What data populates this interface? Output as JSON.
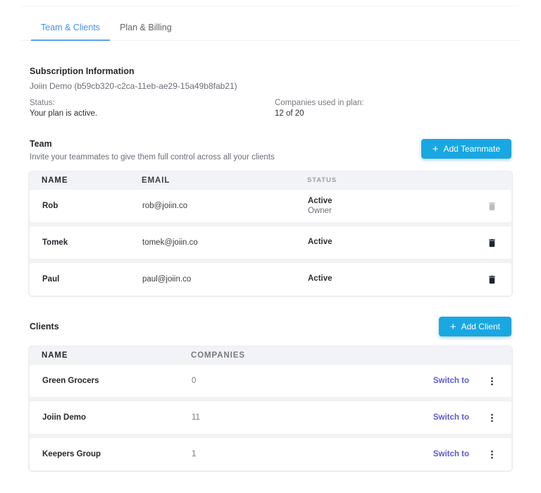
{
  "tabs": [
    {
      "label": "Team & Clients",
      "active": true
    },
    {
      "label": "Plan & Billing",
      "active": false
    }
  ],
  "subscription": {
    "title": "Subscription Information",
    "account": "Joiin Demo (b59cb320-c2ca-11eb-ae29-15a49b8fab21)",
    "status_label": "Status:",
    "status_value": "Your plan is active.",
    "companies_label": "Companies used in plan:",
    "companies_value": "12 of 20"
  },
  "icons": {
    "plus": "+"
  },
  "colors": {
    "accent_blue": "#19a7e2",
    "tab_active": "#478fea",
    "switch_link": "#5b5bd6"
  },
  "team": {
    "title": "Team",
    "subtitle": "Invite your teammates to give them full control across all your clients",
    "add_button_label": "Add Teammate",
    "table": {
      "headers": [
        "NAME",
        "EMAIL",
        "STATUS"
      ],
      "rows": [
        {
          "name": "Rob",
          "email": "rob@joiin.co",
          "status": "Active",
          "role": "Owner",
          "delete_disabled": true
        },
        {
          "name": "Tomek",
          "email": "tomek@joiin.co",
          "status": "Active",
          "role": "",
          "delete_disabled": false
        },
        {
          "name": "Paul",
          "email": "paul@joiin.co",
          "status": "Active",
          "role": "",
          "delete_disabled": false
        }
      ]
    }
  },
  "clients": {
    "title": "Clients",
    "add_button_label": "Add Client",
    "table": {
      "headers": [
        "NAME",
        "COMPANIES"
      ],
      "rows": [
        {
          "name": "Green Grocers",
          "companies": "0",
          "switch_label": "Switch to"
        },
        {
          "name": "Joiin Demo",
          "companies": "11",
          "switch_label": "Switch to"
        },
        {
          "name": "Keepers Group",
          "companies": "1",
          "switch_label": "Switch to"
        }
      ]
    }
  }
}
